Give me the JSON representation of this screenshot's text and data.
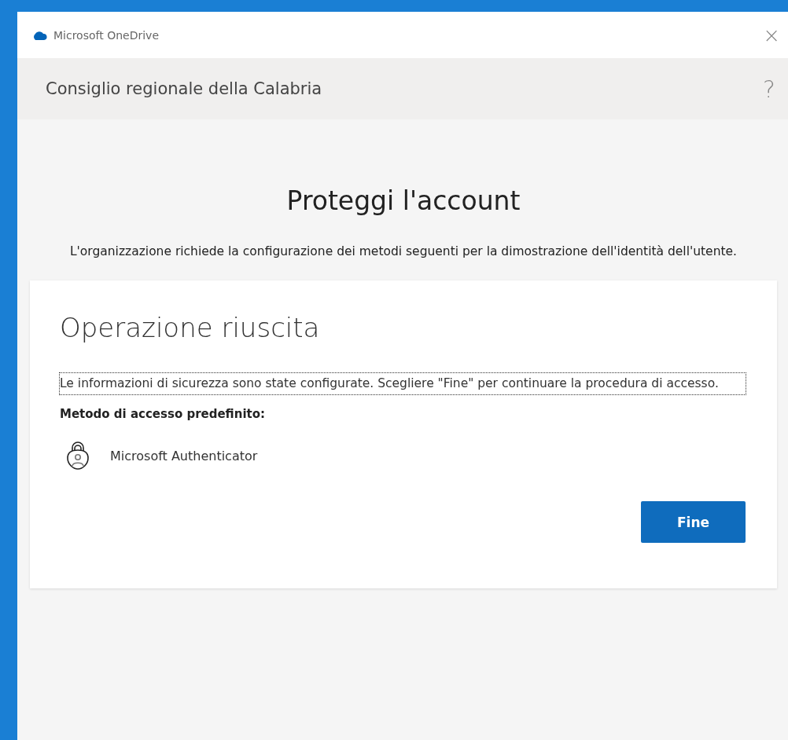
{
  "window": {
    "title": "Microsoft OneDrive",
    "close": "×"
  },
  "header": {
    "organization": "Consiglio regionale della Calabria",
    "help": "?"
  },
  "heading": "Proteggi l'account",
  "intro": "L'organizzazione richiede la configurazione dei metodi seguenti per la dimostrazione dell'identità dell'utente.",
  "card": {
    "title": "Operazione riuscita",
    "message": "Le informazioni di sicurezza sono state configurate. Scegliere \"Fine\" per continuare la procedura di accesso.",
    "message_focused": true,
    "method_label": "Metodo di accesso predefinito:",
    "method": "Microsoft Authenticator",
    "button": "Fine"
  }
}
